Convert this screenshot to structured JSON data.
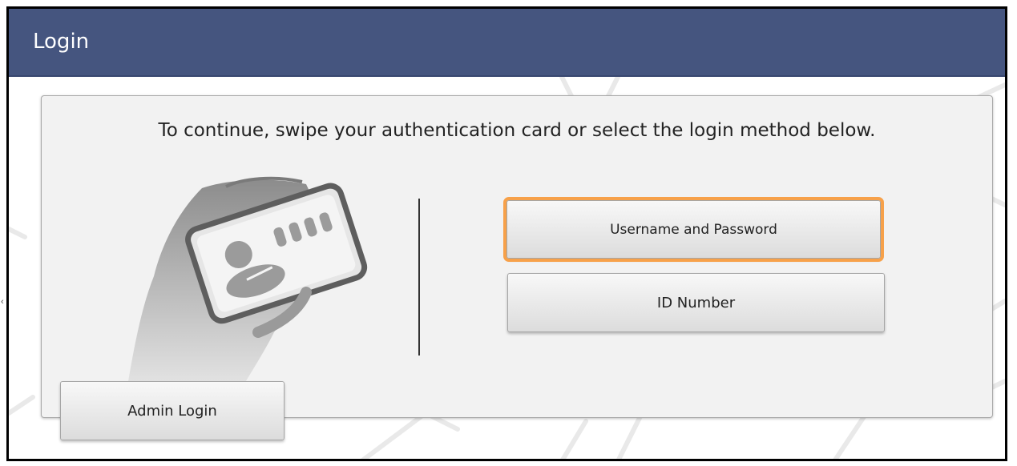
{
  "window": {
    "title": "Login"
  },
  "panel": {
    "instruction": "To continue, swipe your authentication card or select the login method below."
  },
  "login_methods": {
    "username_password_label": "Username and Password",
    "id_number_label": "ID Number"
  },
  "admin": {
    "label": "Admin Login"
  },
  "icons": {
    "card_swipe": "hand-holding-card-icon",
    "side_arrow": "chevron-left-icon"
  },
  "colors": {
    "title_bar": "#45557f",
    "focus_outline": "#f7a14a",
    "panel_bg": "#f2f2f2"
  }
}
